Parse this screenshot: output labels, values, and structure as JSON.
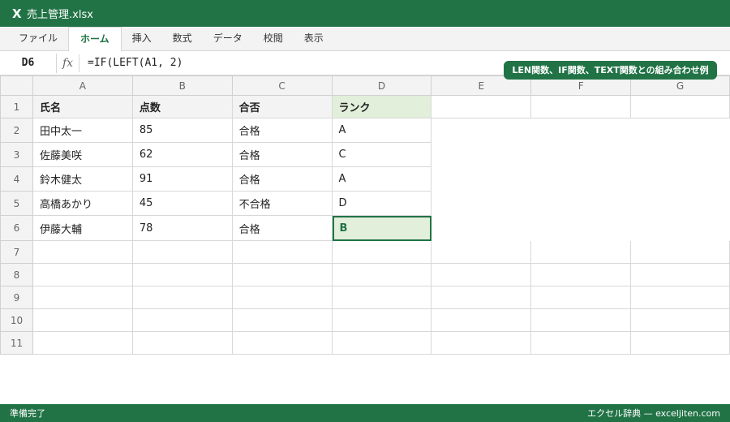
{
  "window": {
    "app_icon": "X",
    "title": "売上管理.xlsx"
  },
  "ribbon": {
    "tabs": [
      "ファイル",
      "ホーム",
      "挿入",
      "数式",
      "データ",
      "校閲",
      "表示"
    ],
    "active_tab": "ホーム"
  },
  "formula_bar": {
    "name_box": "D6",
    "fx_label": "fx",
    "formula": "=IF(LEFT(A1, 2)"
  },
  "banner": "LEN関数、IF関数、TEXT関数との組み合わせ例",
  "sheet": {
    "columns": [
      "A",
      "B",
      "C",
      "D",
      "E",
      "F",
      "G"
    ],
    "rows": [
      {
        "num": "1",
        "cells": [
          "氏名",
          "点数",
          "合否",
          "ランク",
          "",
          "",
          ""
        ]
      },
      {
        "num": "2",
        "cells": [
          "田中太一",
          "85",
          "合格",
          "A"
        ]
      },
      {
        "num": "3",
        "cells": [
          "佐藤美咲",
          "62",
          "合格",
          "C"
        ]
      },
      {
        "num": "4",
        "cells": [
          "鈴木健太",
          "91",
          "合格",
          "A"
        ]
      },
      {
        "num": "5",
        "cells": [
          "高橋あかり",
          "45",
          "不合格",
          "D"
        ]
      },
      {
        "num": "6",
        "cells": [
          "伊藤大輔",
          "78",
          "合格",
          "B"
        ]
      },
      {
        "num": "7",
        "cells": [
          "",
          "",
          "",
          "",
          "",
          "",
          ""
        ]
      },
      {
        "num": "8",
        "cells": [
          "",
          "",
          "",
          "",
          "",
          "",
          ""
        ]
      },
      {
        "num": "9",
        "cells": [
          "",
          "",
          "",
          "",
          "",
          "",
          ""
        ]
      },
      {
        "num": "10",
        "cells": [
          "",
          "",
          "",
          "",
          "",
          "",
          ""
        ]
      },
      {
        "num": "11",
        "cells": [
          "",
          "",
          "",
          "",
          "",
          "",
          ""
        ]
      }
    ],
    "selected_cell": "D6"
  },
  "status": {
    "left": "準備完了",
    "right": "エクセル辞典 — exceljiten.com"
  },
  "colors": {
    "accent": "#217346",
    "header_fill": "#f3f3f3",
    "highlight_fill": "#e2efda"
  }
}
